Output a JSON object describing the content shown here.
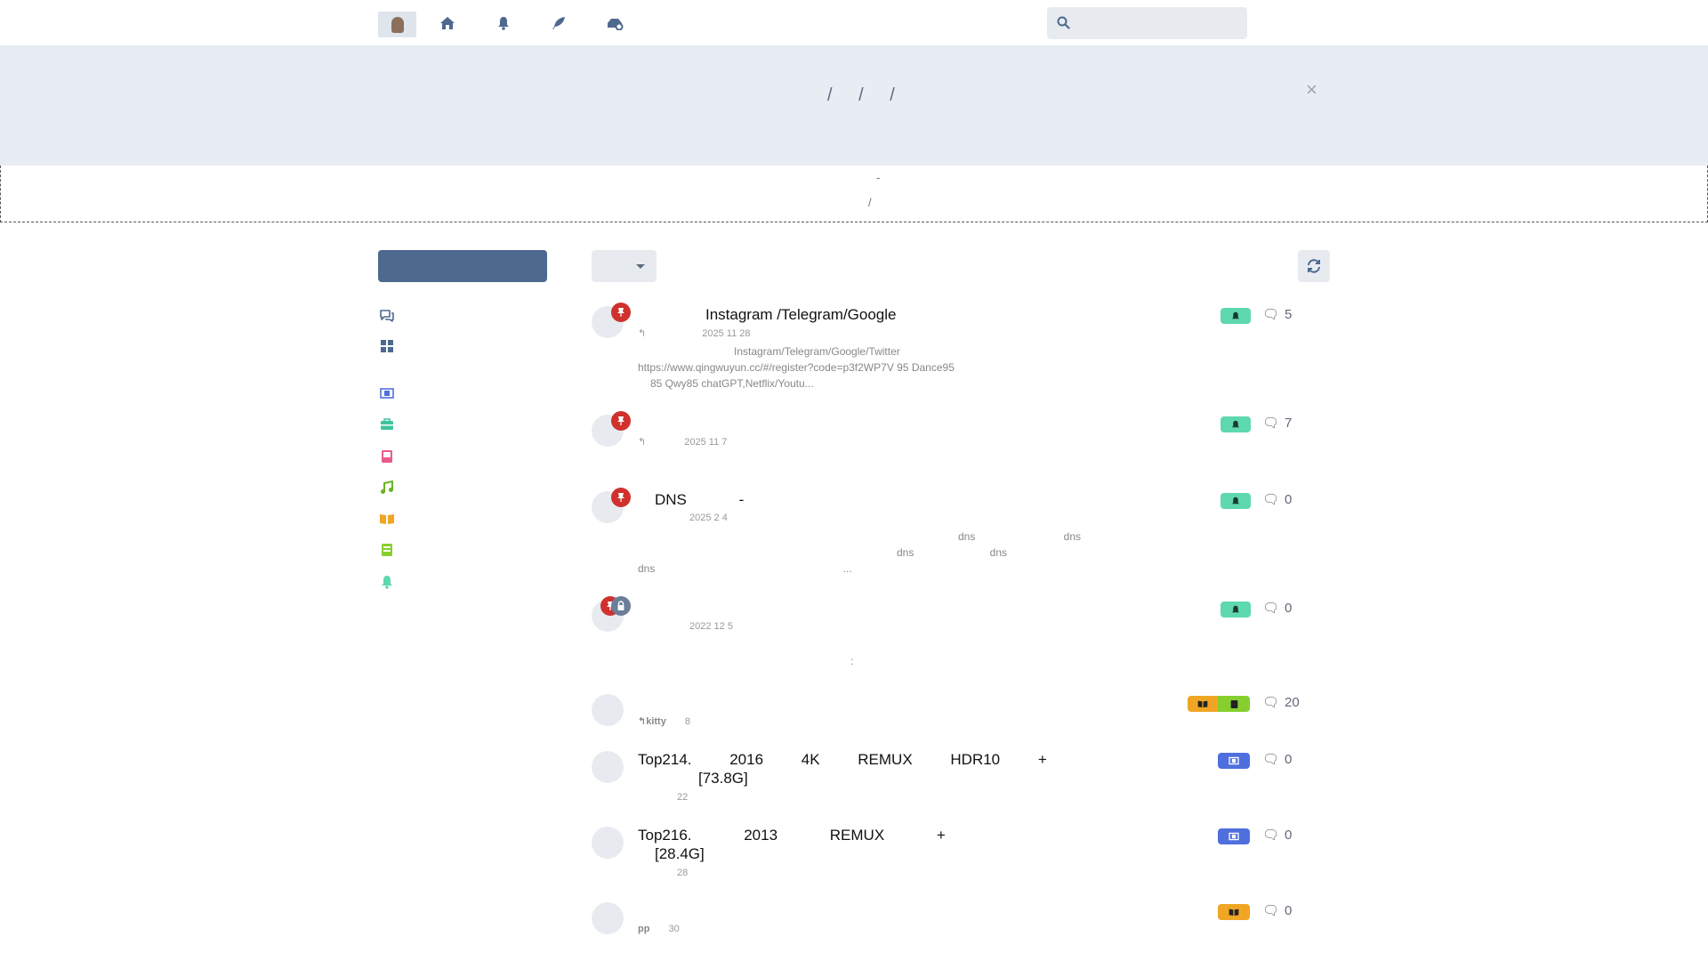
{
  "header": {
    "search_placeholder": ""
  },
  "hero": {
    "crumbs": "/ / /",
    "close": "×"
  },
  "notice": {
    "line1": "-",
    "line2": "/"
  },
  "colors": {
    "pin": "#d0312d",
    "lock": "#6a7e99",
    "tag_green": "#5ed8b0",
    "tag_blue": "#4f6fde",
    "tag_orange": "#f0a524",
    "tag_lime": "#86cf2e",
    "primary": "#4d698e"
  },
  "sidebar": {
    "items": [
      {
        "icon": "comments-icon"
      },
      {
        "icon": "tags-grid-icon"
      },
      {
        "icon": "film-icon"
      },
      {
        "icon": "toolbox-icon"
      },
      {
        "icon": "book-pink-icon"
      },
      {
        "icon": "music-icon"
      },
      {
        "icon": "open-book-icon"
      },
      {
        "icon": "book-green-icon"
      },
      {
        "icon": "bell-icon"
      }
    ]
  },
  "discussions": [
    {
      "title": "Instagram /Telegram/Google",
      "meta": "2025 11 28",
      "excerpt1": "Instagram/Telegram/Google/Twitter",
      "excerpt2": "https://www.qingwuyun.cc/#/register?code=p3f2WP7V 95 Dance95",
      "excerpt3": "85 Qwy85 chatGPT,Netflix/Youtu...",
      "replies": "5"
    },
    {
      "title": "",
      "meta": "2025 11 7",
      "replies": "7"
    },
    {
      "title": "DNS -",
      "meta": "2025 2 4",
      "excerpt1": "dns dns",
      "excerpt2": "dns dns",
      "excerpt3": "dns ...",
      "replies": "0"
    },
    {
      "title": "",
      "meta": "2022 12 5",
      "excerpt1": ":",
      "replies": "0"
    },
    {
      "title": "",
      "meta_user": "kitty",
      "meta": "8",
      "replies": "20"
    },
    {
      "title": "Top214. 2016 4K REMUX HDR10 +",
      "title2": "[73.8G]",
      "meta": "22",
      "replies": "0"
    },
    {
      "title": "Top216. 2013 REMUX +",
      "title2": "[28.4G]",
      "meta": "28",
      "replies": "0"
    },
    {
      "title": "",
      "meta_user": "pp",
      "meta": "30",
      "replies": "0"
    }
  ]
}
